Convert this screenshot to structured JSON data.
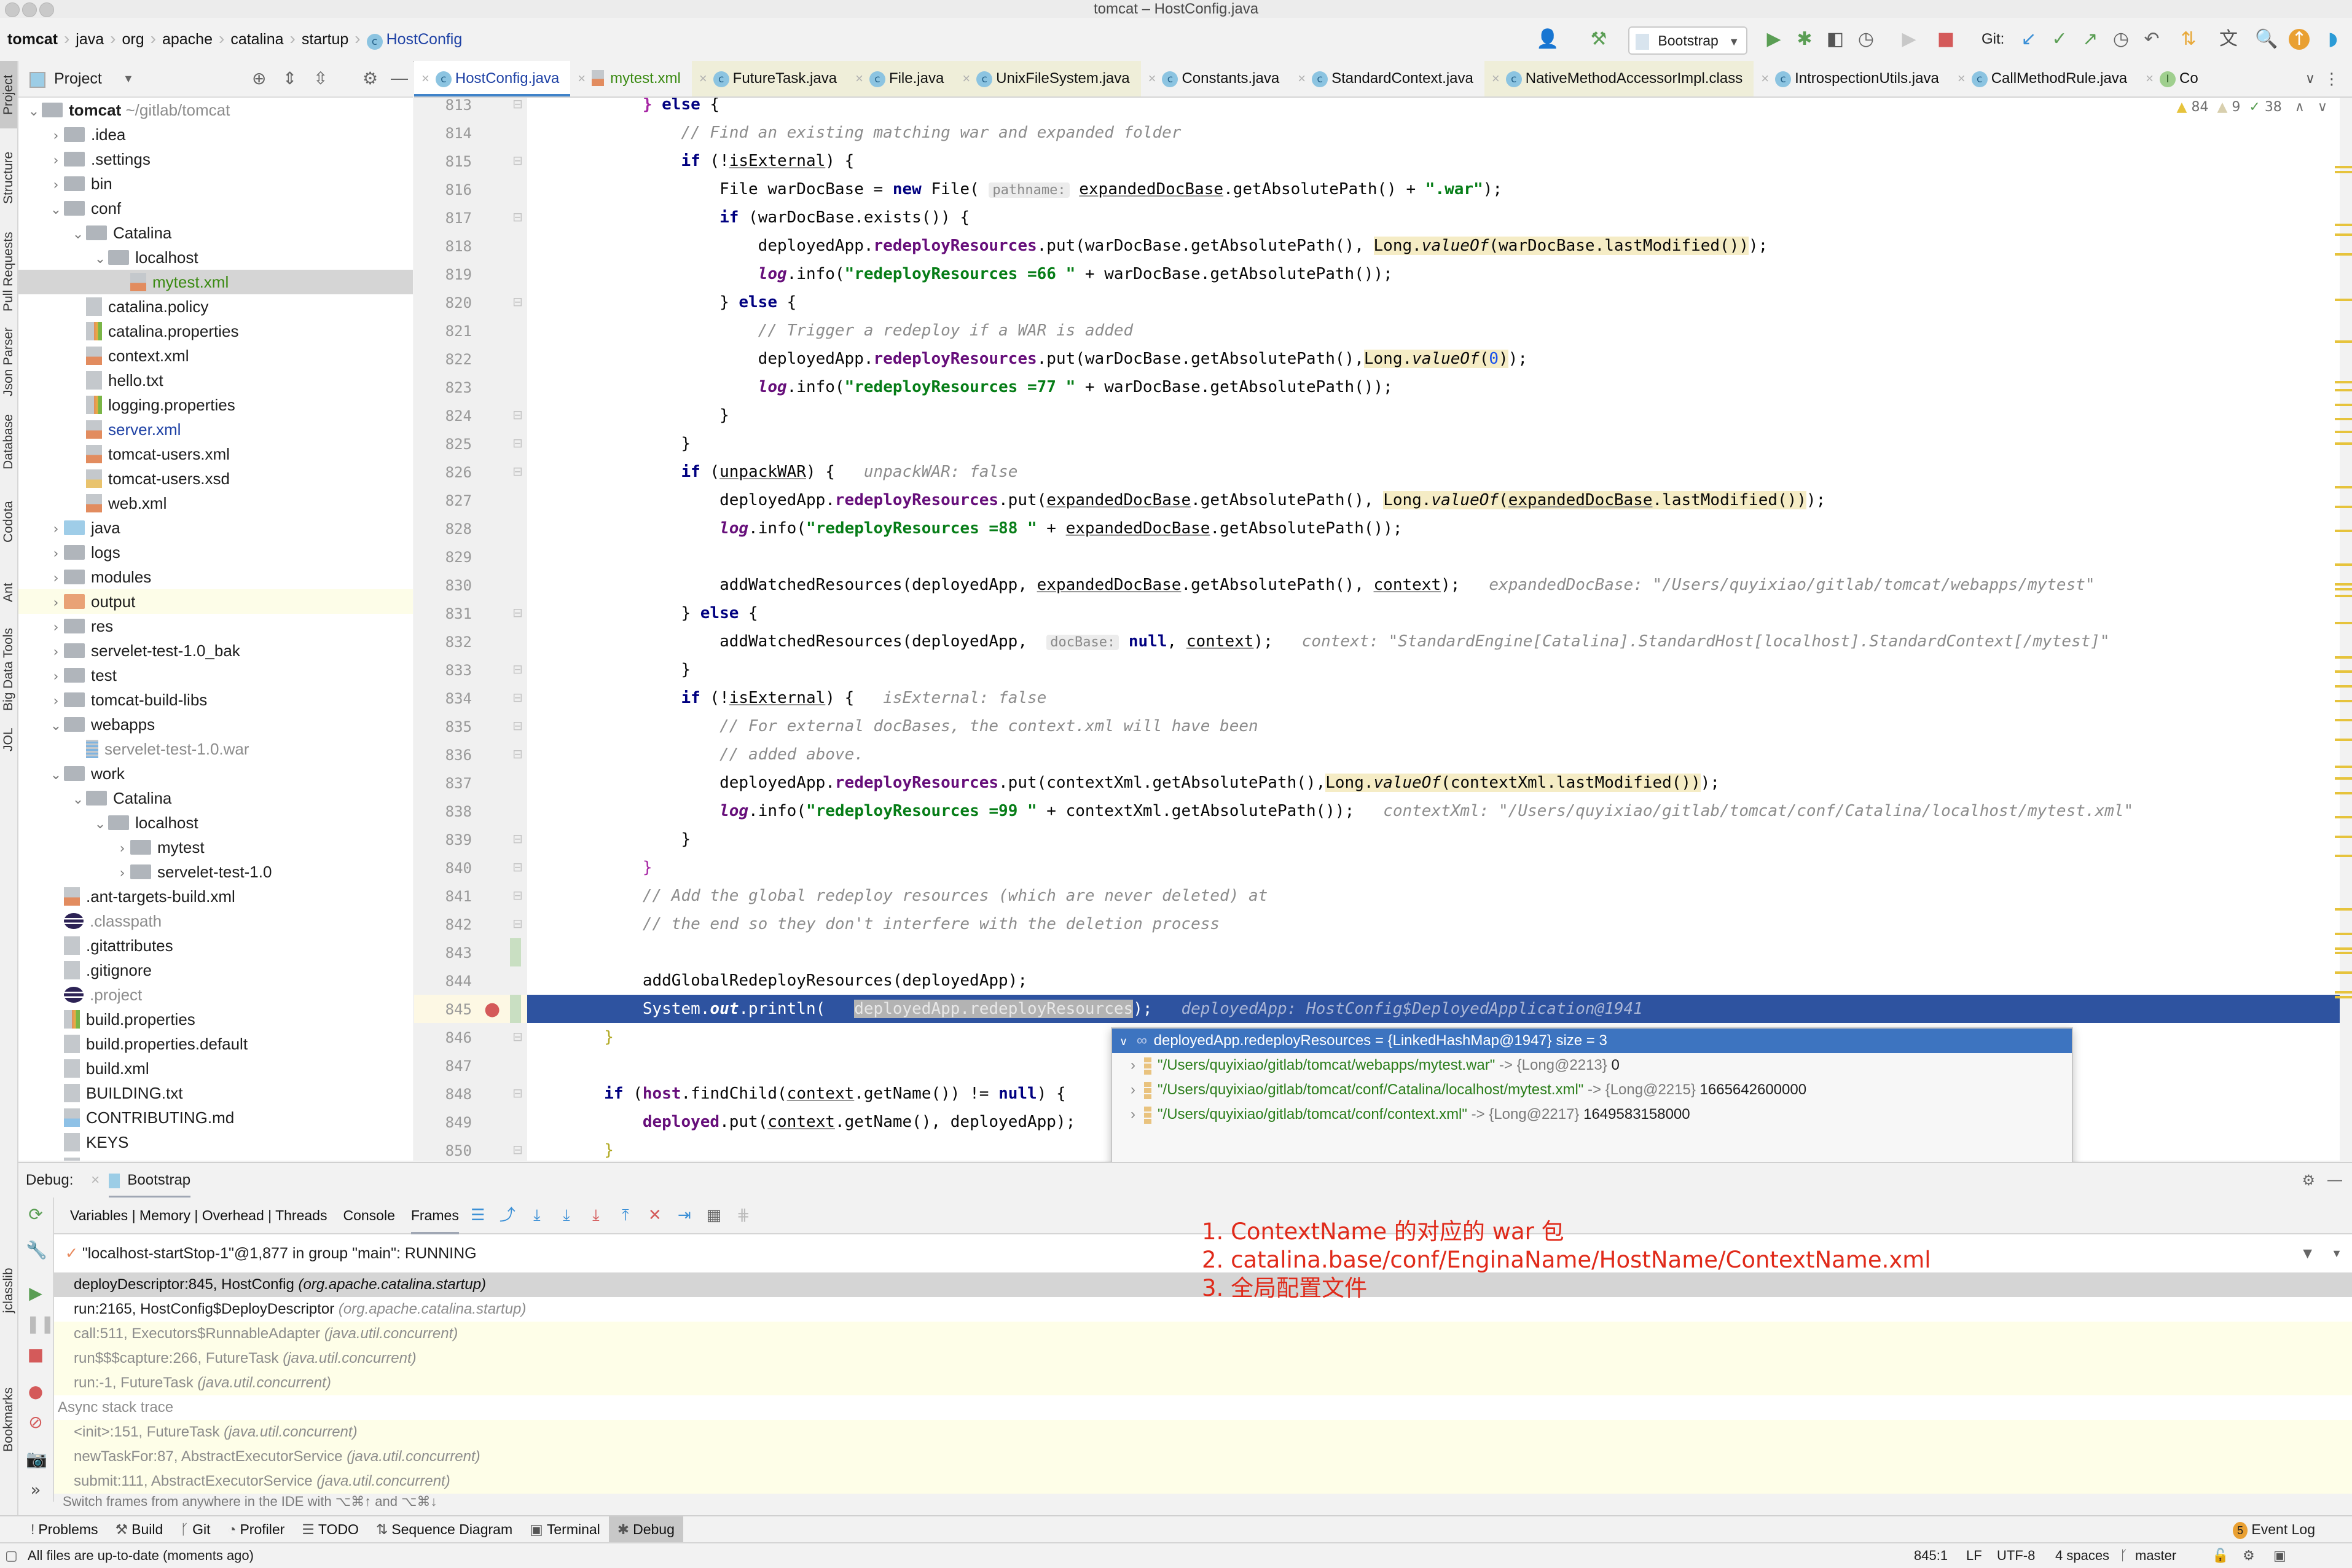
{
  "window": {
    "title": "tomcat – HostConfig.java"
  },
  "breadcrumb": [
    {
      "label": "tomcat",
      "bold": true
    },
    {
      "label": "java"
    },
    {
      "label": "org"
    },
    {
      "label": "apache"
    },
    {
      "label": "catalina"
    },
    {
      "label": "startup"
    },
    {
      "label": "HostConfig",
      "icon": "class-icon"
    }
  ],
  "toolbar": {
    "run_config": "Bootstrap",
    "git_label": "Git:"
  },
  "left_stripe": [
    "Project",
    "Structure",
    "Pull Requests",
    "Json Parser",
    "Database",
    "Codota",
    "Ant",
    "Big Data Tools",
    "JOL"
  ],
  "left_stripe_bottom": [
    "jclasslib",
    "Bookmarks"
  ],
  "project_panel": {
    "title": "Project",
    "tree": [
      {
        "depth": 0,
        "arrow": "down",
        "type": "module",
        "label": "tomcat",
        "suffix": " ~/gitlab/tomcat",
        "bold": true
      },
      {
        "depth": 1,
        "arrow": "right",
        "type": "folder",
        "label": ".idea"
      },
      {
        "depth": 1,
        "arrow": "right",
        "type": "folder",
        "label": ".settings"
      },
      {
        "depth": 1,
        "arrow": "right",
        "type": "folder",
        "label": "bin"
      },
      {
        "depth": 1,
        "arrow": "down",
        "type": "folder",
        "label": "conf"
      },
      {
        "depth": 2,
        "arrow": "down",
        "type": "folder",
        "label": "Catalina"
      },
      {
        "depth": 3,
        "arrow": "down",
        "type": "folder",
        "label": "localhost"
      },
      {
        "depth": 4,
        "arrow": "",
        "type": "xml",
        "label": "mytest.xml",
        "color": "#3a8a12",
        "selected": true
      },
      {
        "depth": 2,
        "arrow": "",
        "type": "text",
        "label": "catalina.policy"
      },
      {
        "depth": 2,
        "arrow": "",
        "type": "prop",
        "label": "catalina.properties"
      },
      {
        "depth": 2,
        "arrow": "",
        "type": "xml",
        "label": "context.xml"
      },
      {
        "depth": 2,
        "arrow": "",
        "type": "text",
        "label": "hello.txt"
      },
      {
        "depth": 2,
        "arrow": "",
        "type": "prop",
        "label": "logging.properties"
      },
      {
        "depth": 2,
        "arrow": "",
        "type": "xml",
        "label": "server.xml",
        "color": "#1f42a5"
      },
      {
        "depth": 2,
        "arrow": "",
        "type": "xml",
        "label": "tomcat-users.xml"
      },
      {
        "depth": 2,
        "arrow": "",
        "type": "xsd",
        "label": "tomcat-users.xsd"
      },
      {
        "depth": 2,
        "arrow": "",
        "type": "xml",
        "label": "web.xml"
      },
      {
        "depth": 1,
        "arrow": "right",
        "type": "folder-blue",
        "label": "java"
      },
      {
        "depth": 1,
        "arrow": "right",
        "type": "folder",
        "label": "logs"
      },
      {
        "depth": 1,
        "arrow": "right",
        "type": "folder",
        "label": "modules"
      },
      {
        "depth": 1,
        "arrow": "right",
        "type": "folder-orange",
        "label": "output",
        "highlight": true
      },
      {
        "depth": 1,
        "arrow": "right",
        "type": "folder",
        "label": "res"
      },
      {
        "depth": 1,
        "arrow": "right",
        "type": "folder",
        "label": "servelet-test-1.0_bak"
      },
      {
        "depth": 1,
        "arrow": "right",
        "type": "folder",
        "label": "test"
      },
      {
        "depth": 1,
        "arrow": "right",
        "type": "folder",
        "label": "tomcat-build-libs"
      },
      {
        "depth": 1,
        "arrow": "down",
        "type": "folder",
        "label": "webapps"
      },
      {
        "depth": 2,
        "arrow": "",
        "type": "war",
        "label": "servelet-test-1.0.war",
        "color": "#8c8c8c"
      },
      {
        "depth": 1,
        "arrow": "down",
        "type": "folder",
        "label": "work"
      },
      {
        "depth": 2,
        "arrow": "down",
        "type": "folder",
        "label": "Catalina"
      },
      {
        "depth": 3,
        "arrow": "down",
        "type": "folder",
        "label": "localhost"
      },
      {
        "depth": 4,
        "arrow": "right",
        "type": "folder",
        "label": "mytest"
      },
      {
        "depth": 4,
        "arrow": "right",
        "type": "folder",
        "label": "servelet-test-1.0"
      },
      {
        "depth": 1,
        "arrow": "",
        "type": "xml",
        "label": ".ant-targets-build.xml"
      },
      {
        "depth": 1,
        "arrow": "",
        "type": "eclipse",
        "label": ".classpath",
        "color": "#8c8c8c"
      },
      {
        "depth": 1,
        "arrow": "",
        "type": "text",
        "label": ".gitattributes"
      },
      {
        "depth": 1,
        "arrow": "",
        "type": "text",
        "label": ".gitignore"
      },
      {
        "depth": 1,
        "arrow": "",
        "type": "eclipse",
        "label": ".project",
        "color": "#8c8c8c"
      },
      {
        "depth": 1,
        "arrow": "",
        "type": "prop",
        "label": "build.properties"
      },
      {
        "depth": 1,
        "arrow": "",
        "type": "text",
        "label": "build.properties.default"
      },
      {
        "depth": 1,
        "arrow": "",
        "type": "text",
        "label": "build.xml"
      },
      {
        "depth": 1,
        "arrow": "",
        "type": "text",
        "label": "BUILDING.txt"
      },
      {
        "depth": 1,
        "arrow": "",
        "type": "md",
        "label": "CONTRIBUTING.md"
      },
      {
        "depth": 1,
        "arrow": "",
        "type": "text",
        "label": "KEYS"
      },
      {
        "depth": 1,
        "arrow": "",
        "type": "text",
        "label": "LICENSE"
      }
    ]
  },
  "tabs": [
    {
      "label": "HostConfig.java",
      "icon": "class",
      "active": true
    },
    {
      "label": "mytest.xml",
      "icon": "xml",
      "color": "#3a8a12"
    },
    {
      "label": "FutureTask.java",
      "icon": "class",
      "yellow": true
    },
    {
      "label": "File.java",
      "icon": "class",
      "yellow": true
    },
    {
      "label": "UnixFileSystem.java",
      "icon": "class",
      "yellow": true
    },
    {
      "label": "Constants.java",
      "icon": "class"
    },
    {
      "label": "StandardContext.java",
      "icon": "class"
    },
    {
      "label": "NativeMethodAccessorImpl.class",
      "icon": "class",
      "yellow": true
    },
    {
      "label": "IntrospectionUtils.java",
      "icon": "class"
    },
    {
      "label": "CallMethodRule.java",
      "icon": "class"
    },
    {
      "label": "Co",
      "icon": "interface"
    }
  ],
  "inspections": {
    "warnings": "84",
    "weak_warnings": "9",
    "typos": "38"
  },
  "editor": {
    "first_line": 813,
    "current_line": 845,
    "lines": [
      {
        "n": 813,
        "html": "            <span class='fld' style='color:#a626a4'>}</span> <span class='kw'>else</span> {"
      },
      {
        "n": 814,
        "html": "                <span class='cmt'>// Find an existing matching war and expanded folder</span>"
      },
      {
        "n": 815,
        "html": "                <span class='kw'>if</span> (!<span class='und'>isExternal</span>) {"
      },
      {
        "n": 816,
        "html": "                    File warDocBase = <span class='kw'>new</span> File( <span class='param'>pathname:</span> <span class='und'>expandedDocBase</span>.getAbsolutePath() + <span class='str'>\".war\"</span>);"
      },
      {
        "n": 817,
        "html": "                    <span class='kw'>if</span> (warDocBase.exists()) {"
      },
      {
        "n": 818,
        "html": "                        deployedApp.<span class='fld'>redeployResources</span>.put(warDocBase.getAbsolutePath(), <span class='hlbg'>Long.<span class='ital'>valueOf</span>(warDocBase.lastModified())</span>);"
      },
      {
        "n": 819,
        "html": "                        <span class='fld ital'>log</span>.info(<span class='str'>\"redeployResources =66 \"</span> + warDocBase.getAbsolutePath());"
      },
      {
        "n": 820,
        "html": "                    } <span class='kw'>else</span> {"
      },
      {
        "n": 821,
        "html": "                        <span class='cmt'>// Trigger a redeploy if a WAR is added</span>"
      },
      {
        "n": 822,
        "html": "                        deployedApp.<span class='fld'>redeployResources</span>.put(warDocBase.getAbsolutePath(),<span class='hlbg'>Long.<span class='ital'>valueOf</span>(<span class='num'>0</span>)</span>);"
      },
      {
        "n": 823,
        "html": "                        <span class='fld ital'>log</span>.info(<span class='str'>\"redeployResources =77 \"</span> + warDocBase.getAbsolutePath());"
      },
      {
        "n": 824,
        "html": "                    }"
      },
      {
        "n": 825,
        "html": "                }"
      },
      {
        "n": 826,
        "html": "                <span class='kw'>if</span> (<span class='und'>unpackWAR</span>) {   <span class='hint'>unpackWAR: false</span>"
      },
      {
        "n": 827,
        "html": "                    deployedApp.<span class='fld'>redeployResources</span>.put(<span class='und'>expandedDocBase</span>.getAbsolutePath(), <span class='hlbg'>Long.<span class='ital'>valueOf</span>(<span class='und'>expandedDocBase</span>.lastModified())</span>);"
      },
      {
        "n": 828,
        "html": "                    <span class='fld ital'>log</span>.info(<span class='str'>\"redeployResources =88 \"</span> + <span class='und'>expandedDocBase</span>.getAbsolutePath());"
      },
      {
        "n": 829,
        "html": ""
      },
      {
        "n": 830,
        "html": "                    addWatchedResources(deployedApp, <span class='und'>expandedDocBase</span>.getAbsolutePath(), <span class='und'>context</span>);   <span class='hint'>expandedDocBase: \"/Users/quyixiao/gitlab/tomcat/webapps/mytest\"</span>"
      },
      {
        "n": 831,
        "html": "                } <span class='kw'>else</span> {"
      },
      {
        "n": 832,
        "html": "                    addWatchedResources(deployedApp,  <span class='param'>docBase:</span> <span class='kw'>null</span>, <span class='und'>context</span>);   <span class='hint'>context: \"StandardEngine[Catalina].StandardHost[localhost].StandardContext[/mytest]\"</span>"
      },
      {
        "n": 833,
        "html": "                }"
      },
      {
        "n": 834,
        "html": "                <span class='kw'>if</span> (!<span class='und'>isExternal</span>) {   <span class='hint'>isExternal: false</span>"
      },
      {
        "n": 835,
        "html": "                    <span class='cmt'>// For external docBases, the context.xml will have been</span>"
      },
      {
        "n": 836,
        "html": "                    <span class='cmt'>// added above.</span>"
      },
      {
        "n": 837,
        "html": "                    deployedApp.<span class='fld'>redeployResources</span>.put(contextXml.getAbsolutePath(),<span class='hlbg'>Long.<span class='ital'>valueOf</span>(contextXml.lastModified())</span>);"
      },
      {
        "n": 838,
        "html": "                    <span class='fld ital'>log</span>.info(<span class='str'>\"redeployResources =99 \"</span> + contextXml.getAbsolutePath());   <span class='hint'>contextXml: \"/Users/quyixiao/gitlab/tomcat/conf/Catalina/localhost/mytest.xml\"</span>"
      },
      {
        "n": 839,
        "html": "                }"
      },
      {
        "n": 840,
        "html": "            <span style='color:#a626a4'>}</span>"
      },
      {
        "n": 841,
        "html": "            <span class='cmt'>// Add the global redeploy resources (which are never deleted) at</span>"
      },
      {
        "n": 842,
        "html": "            <span class='cmt'>// the end so they don't interfere with the deletion process</span>"
      },
      {
        "n": 843,
        "html": ""
      },
      {
        "n": 844,
        "html": "            addGlobalRedeployResources(deployedApp);"
      },
      {
        "n": 845,
        "html": "            System.<span class='ital' style='font-weight:bold'>out</span>.println(   <span class='selbox'>deployedApp.redeployResources</span>);   <span class='hint'>deployedApp: HostConfig$DeployedApplication@1941</span>",
        "exec": true
      },
      {
        "n": 846,
        "html": "        <span style='color:#b0a820'>}</span>"
      },
      {
        "n": 847,
        "html": ""
      },
      {
        "n": 848,
        "html": "        <span class='kw'>if</span> (<span class='fld'>host</span>.findChild(<span class='und'>context</span>.getName()) != <span class='kw'>null</span>) {"
      },
      {
        "n": 849,
        "html": "            <span class='fld'>deployed</span>.put(<span class='und'>context</span>.getName(), deployedApp);"
      },
      {
        "n": 850,
        "html": "        <span style='color:#b0a820'>}</span>"
      }
    ]
  },
  "popup": {
    "header": "deployedApp.redeployResources = {LinkedHashMap@1947}  size = 3",
    "entries": [
      {
        "key": "\"/Users/quyixiao/gitlab/tomcat/webapps/mytest.war\"",
        "ref": "{Long@2213}",
        "value": "0"
      },
      {
        "key": "\"/Users/quyixiao/gitlab/tomcat/conf/Catalina/localhost/mytest.xml\"",
        "ref": "{Long@2215}",
        "value": "1665642600000"
      },
      {
        "key": "\"/Users/quyixiao/gitlab/tomcat/conf/context.xml\"",
        "ref": "{Long@2217}",
        "value": "1649583158000"
      }
    ]
  },
  "debug": {
    "label": "Debug:",
    "session": "Bootstrap",
    "tabs": [
      {
        "label": "Variables | Memory | Overhead | Threads"
      },
      {
        "label": "Console"
      },
      {
        "label": "Frames",
        "active": true
      }
    ],
    "thread": "\"localhost-startStop-1\"@1,877 in group \"main\": RUNNING",
    "frames": [
      {
        "method": "deployDescriptor:845, HostConfig",
        "pkg": "(org.apache.catalina.startup)",
        "kind": "sel"
      },
      {
        "method": "run:2165, HostConfig$DeployDescriptor",
        "pkg": "(org.apache.catalina.startup)",
        "kind": "plain"
      },
      {
        "method": "call:511, Executors$RunnableAdapter",
        "pkg": "(java.util.concurrent)",
        "kind": "lib"
      },
      {
        "method": "run$$$capture:266, FutureTask",
        "pkg": "(java.util.concurrent)",
        "kind": "lib"
      },
      {
        "method": "run:-1, FutureTask",
        "pkg": "(java.util.concurrent)",
        "kind": "lib"
      }
    ],
    "async_header": "Async stack trace",
    "async_frames": [
      {
        "method": "<init>:151, FutureTask",
        "pkg": "(java.util.concurrent)"
      },
      {
        "method": "newTaskFor:87, AbstractExecutorService",
        "pkg": "(java.util.concurrent)"
      },
      {
        "method": "submit:111, AbstractExecutorService",
        "pkg": "(java.util.concurrent)"
      }
    ],
    "hint": "Switch frames from anywhere in the IDE with ⌥⌘↑ and ⌥⌘↓"
  },
  "annotation": [
    "1. ContextName 的对应的 war 包",
    "2. catalina.base/conf/EnginaName/HostName/ContextName.xml",
    "3. 全局配置文件"
  ],
  "tool_tabs": [
    {
      "label": "Problems",
      "icon": "!"
    },
    {
      "label": "Build",
      "icon": "⚒"
    },
    {
      "label": "Git",
      "icon": "ᚴ"
    },
    {
      "label": "Profiler",
      "icon": "◔"
    },
    {
      "label": "TODO",
      "icon": "☰"
    },
    {
      "label": "Sequence Diagram",
      "icon": "⇅"
    },
    {
      "label": "Terminal",
      "icon": "▣"
    },
    {
      "label": "Debug",
      "icon": "✱",
      "active": true
    }
  ],
  "event_log": {
    "count": "5",
    "label": "Event Log"
  },
  "status": {
    "message": "All files are up-to-date (moments ago)",
    "position": "845:1",
    "line_sep": "LF",
    "encoding": "UTF-8",
    "indent": "4 spaces",
    "branch": "master"
  },
  "colors": {
    "accent": "#2e53a0",
    "popup_header": "#3d74c0",
    "annotation": "#e02a1a"
  }
}
